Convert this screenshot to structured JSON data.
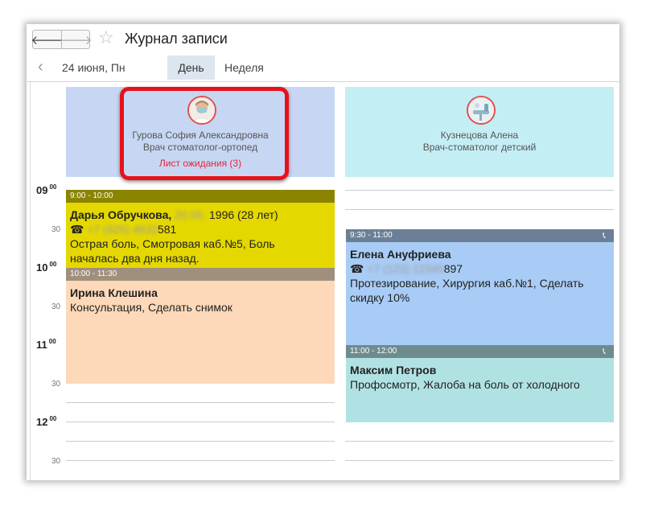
{
  "window": {
    "title": "Журнал записи",
    "nav_back": "🡐",
    "nav_forward": "🡒",
    "favorite_icon": "star-icon"
  },
  "toolbar": {
    "prev_arrow": "‹",
    "date": "24 июня, Пн",
    "tab_day": "День",
    "tab_week": "Неделя"
  },
  "doctors": [
    {
      "name": "Гурова София Александровна",
      "role": "Врач стоматолог-ортопед",
      "waitlist": "Лист ожидания (3)",
      "color": "#c7d7f3"
    },
    {
      "name": "Кузнецова Алена",
      "role": "Врач-стоматолог детский",
      "color": "#c3eef4"
    }
  ],
  "timeline": {
    "h9": "09",
    "h10": "10",
    "h11": "11",
    "h12": "12",
    "min00": "00",
    "min30": "30"
  },
  "appointments": {
    "a1": {
      "time": "9:00 - 10:00",
      "name": "Дарья Обручкова,",
      "dob_hidden": "20.05.",
      "dob_visible": "1996 (28 лет)",
      "phone_icon": "☎",
      "phone_hidden": "+7 (925) 4632",
      "phone_visible": "581",
      "note1": "Острая боль, Смотровая каб.№5, Боль",
      "note2": "началась два дня назад.",
      "head_color": "#8b8400",
      "body_color": "#e5d800"
    },
    "a2": {
      "time": "10:00 - 11:30",
      "name": "Ирина Клешина",
      "note1": "Консультация, Сделать снимок",
      "head_color": "#a08f7c",
      "body_color": "#fdd9b9"
    },
    "a3": {
      "time": "9:30 - 11:00",
      "name": "Елена Ануфриева",
      "phone_icon": "☎",
      "phone_hidden": "+7 (123) 12345",
      "phone_visible": "897",
      "note1": "Протезирование, Хирургия каб.№1, Сделать",
      "note2": "скидку 10%",
      "head_color": "#6b7f96",
      "body_color": "#a8ccf5"
    },
    "a4": {
      "time": "11:00 - 12:00",
      "name": "Максим Петров",
      "note1": "Профосмотр, Жалоба на боль от холодного",
      "head_color": "#6e8b8e",
      "body_color": "#b1e2e3"
    }
  }
}
